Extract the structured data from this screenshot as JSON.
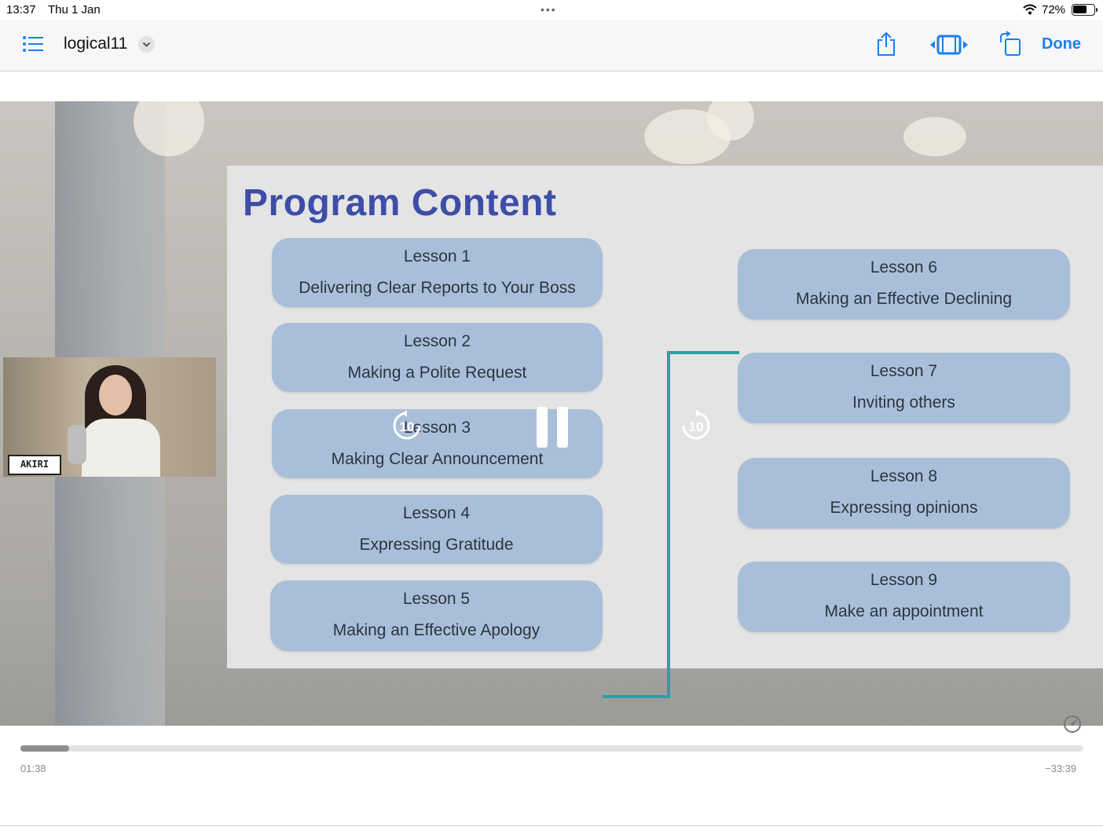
{
  "status_bar": {
    "time": "13:37",
    "date": "Thu 1 Jan",
    "battery": "72%",
    "battery_level": 0.72
  },
  "toolbar": {
    "title": "logical11",
    "done_label": "Done"
  },
  "slide": {
    "title": "Program Content",
    "lessons": [
      {
        "number": "Lesson 1",
        "title": "Delivering Clear Reports to Your Boss"
      },
      {
        "number": "Lesson 2",
        "title": "Making a Polite Request"
      },
      {
        "number": "Lesson 3",
        "title": "Making Clear Announcement"
      },
      {
        "number": "Lesson 4",
        "title": "Expressing Gratitude"
      },
      {
        "number": "Lesson 5",
        "title": "Making an Effective Apology"
      },
      {
        "number": "Lesson 6",
        "title": "Making an Effective Declining"
      },
      {
        "number": "Lesson 7",
        "title": "Inviting others"
      },
      {
        "number": "Lesson 8",
        "title": "Expressing opinions"
      },
      {
        "number": "Lesson 9",
        "title": "Make an appointment"
      }
    ]
  },
  "webcam": {
    "name_tag": "AKIRI"
  },
  "player": {
    "skip_back": "10",
    "skip_forward": "10",
    "elapsed": "01:38",
    "remaining": "−33:39",
    "progress": 0.046
  },
  "icons": [
    "list-icon",
    "chevron-down-icon",
    "share-icon",
    "picture-in-picture-icon",
    "rotate-icon",
    "skip-back-icon",
    "pause-icon",
    "skip-forward-icon",
    "playback-speed-icon",
    "wifi-icon",
    "battery-icon"
  ],
  "colors": {
    "accent": "#1a7ef0",
    "slide_title": "#3d4ea8",
    "lesson_box": "#a9bfd9",
    "connector": "#2aa1a5"
  }
}
